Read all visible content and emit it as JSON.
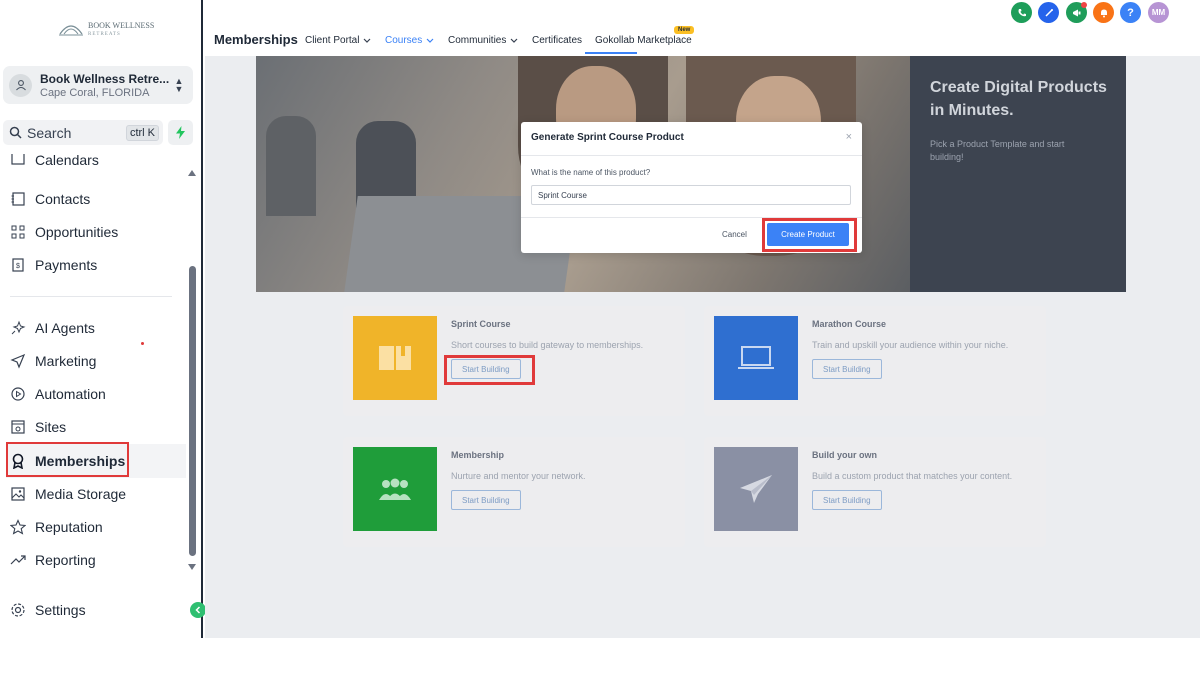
{
  "logo": {
    "line1": "BOOK WELLNESS",
    "line2": "RETREATS"
  },
  "location": {
    "name": "Book Wellness Retre...",
    "city": "Cape Coral, FLORIDA"
  },
  "search": {
    "label": "Search",
    "shortcut": "ctrl K"
  },
  "sidebar": {
    "items": [
      {
        "label": "Calendars"
      },
      {
        "label": "Contacts"
      },
      {
        "label": "Opportunities"
      },
      {
        "label": "Payments"
      },
      {
        "label": "AI Agents"
      },
      {
        "label": "Marketing"
      },
      {
        "label": "Automation"
      },
      {
        "label": "Sites"
      },
      {
        "label": "Memberships"
      },
      {
        "label": "Media Storage"
      },
      {
        "label": "Reputation"
      },
      {
        "label": "Reporting"
      }
    ],
    "settings": "Settings"
  },
  "header": {
    "title": "Memberships",
    "tabs": [
      {
        "label": "Client Portal"
      },
      {
        "label": "Courses"
      },
      {
        "label": "Communities"
      },
      {
        "label": "Certificates"
      },
      {
        "label": "Gokollab Marketplace"
      }
    ],
    "new_badge": "New",
    "avatar_initials": "MM"
  },
  "hero": {
    "title": "Create Digital Products in Minutes.",
    "subtitle": "Pick a Product Template and start building!"
  },
  "cards": [
    {
      "title": "Sprint Course",
      "desc": "Short courses to build gateway to memberships.",
      "button": "Start Building",
      "color": "#f0b429"
    },
    {
      "title": "Marathon Course",
      "desc": "Train and upskill your audience within your niche.",
      "button": "Start Building",
      "color": "#2f6fd0"
    },
    {
      "title": "Membership",
      "desc": "Nurture and mentor your network.",
      "button": "Start Building",
      "color": "#1f9d3a"
    },
    {
      "title": "Build your own",
      "desc": "Build a custom product that matches your content.",
      "button": "Start Building",
      "color": "#8a90a4"
    }
  ],
  "modal": {
    "title": "Generate Sprint Course Product",
    "close": "×",
    "question": "What is the name of this product?",
    "input_value": "Sprint Course",
    "cancel": "Cancel",
    "create": "Create Product"
  }
}
